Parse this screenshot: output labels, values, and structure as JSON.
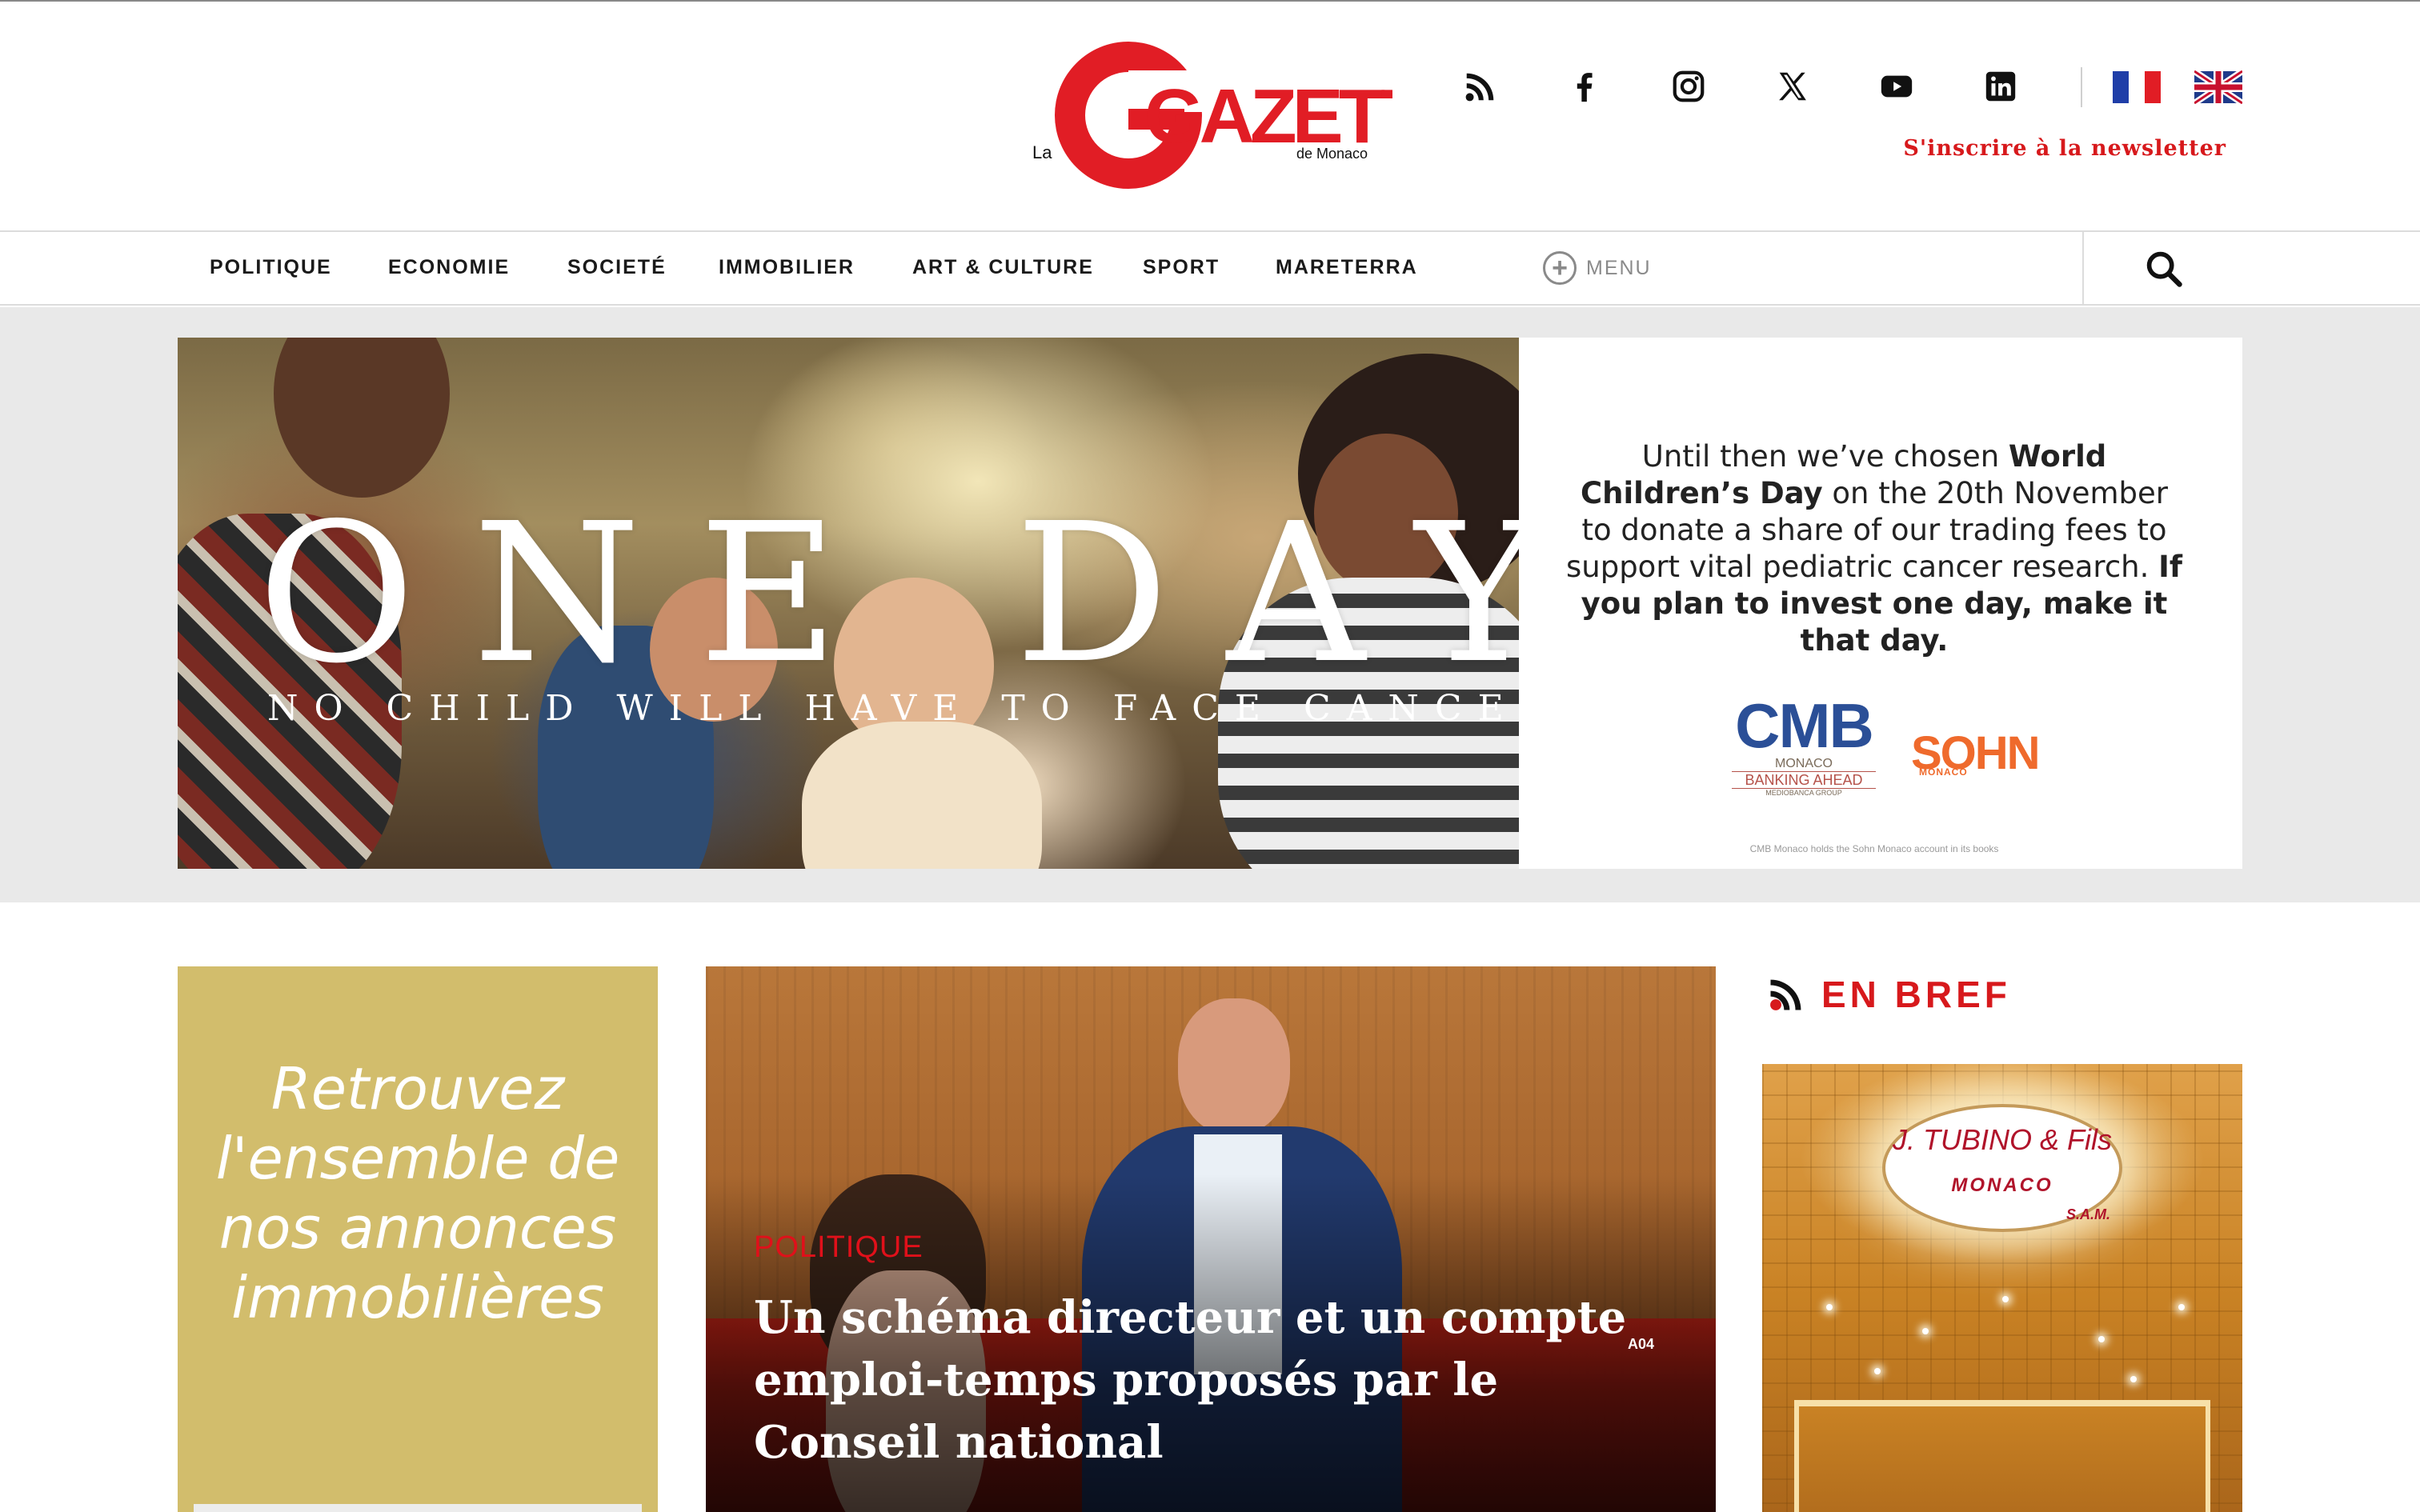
{
  "header": {
    "logo": {
      "prefix": "La",
      "name": "GAZETTE",
      "suffix": "de Monaco"
    },
    "social_icons": [
      "rss-icon",
      "facebook-icon",
      "instagram-icon",
      "x-icon",
      "youtube-icon",
      "linkedin-icon"
    ],
    "language_flags": [
      "french-flag-icon",
      "uk-flag-icon"
    ],
    "newsletter_label": "S'inscrire à la newsletter"
  },
  "nav": {
    "items": [
      "POLITIQUE",
      "ECONOMIE",
      "SOCIETÉ",
      "IMMOBILIER",
      "ART & CULTURE",
      "SPORT",
      "MARETERRA"
    ],
    "menu_label": "MENU",
    "search_icon": "search-icon"
  },
  "banner": {
    "headline": "ONE DAY",
    "subline": "NO CHILD WILL HAVE TO FACE CANCER",
    "text_1": "Until then we’ve chosen ",
    "text_bold_1": "World Children’s Day",
    "text_2": " on the 20th November to donate a share of our trading fees to support vital pediatric cancer research. ",
    "text_bold_2": "If you plan to invest one day, make it that day.",
    "cmb_logo": "CMB",
    "cmb_city": "MONACO",
    "cmb_tagline": "BANKING AHEAD",
    "cmb_group": "MEDIOBANCA GROUP",
    "sohn_logo": "SOHN",
    "sohn_city": "MONACO",
    "fineprint": "CMB Monaco holds the Sohn Monaco account in its books"
  },
  "promo_left": {
    "text": "Retrouvez l'ensemble de nos annonces immobilières"
  },
  "main_story": {
    "category": "POLITIQUE",
    "headline": "Un schéma directeur et un compte emploi-temps proposés par le Conseil national",
    "seat_label": "A04"
  },
  "sidebar": {
    "title": "EN BREF",
    "ad": {
      "name": "J. TUBINO & Fils",
      "city": "MONACO",
      "suffix": "S.A.M."
    }
  },
  "colors": {
    "brand_red": "#d7191c",
    "promo_gold": "#d2bd6c",
    "nav_text": "#1a1a1a"
  }
}
